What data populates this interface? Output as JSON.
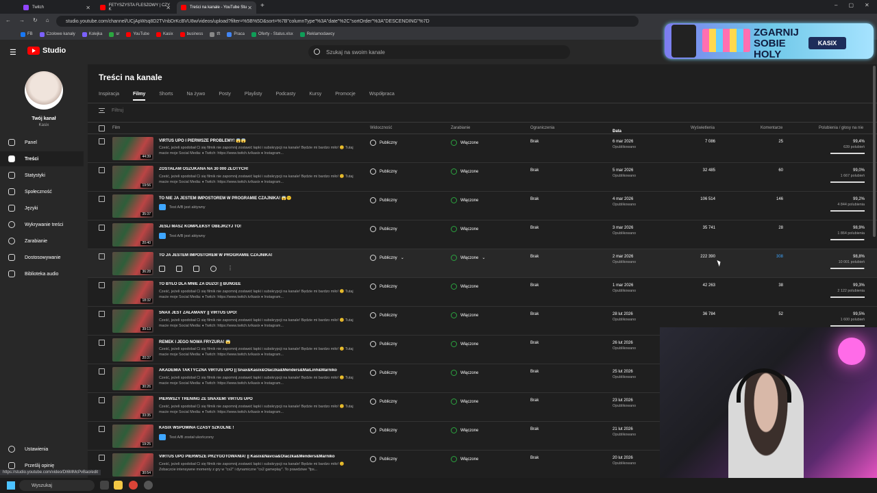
{
  "browser": {
    "tabs": [
      {
        "label": "Twitch",
        "color": "#9146ff"
      },
      {
        "label": "FETYSZYSTA FLESZOWY | CZY K",
        "color": "#ff0000"
      },
      {
        "label": "Treści na kanale - YouTube Stu",
        "color": "#ff0000"
      }
    ],
    "url": "studio.youtube.com/channel/UCjApWsq8D2TVnbDrKcBVU8w/videos/upload?filter=%5B%5D&sort=%7B\"columnType\"%3A\"date\"%2C\"sortOrder\"%3A\"DESCENDING\"%7D",
    "bookmarks": [
      "FB",
      "Czołowe kanały",
      "Kolejka",
      "sr",
      "YouTube",
      "Kasix",
      "business",
      "tft",
      "Praca",
      "Oferty - Status.xlsx",
      "Reklamodawcy"
    ]
  },
  "header": {
    "logo": "Studio",
    "search_placeholder": "Szukaj na swoim kanale"
  },
  "promo": {
    "text": "ZGARNIJ SOBIE HOLY HYDRATION",
    "badge": "KASIX"
  },
  "sidebar": {
    "channel_label": "Twój kanał",
    "channel_name": "Kasix",
    "items": [
      "Panel",
      "Treści",
      "Statystyki",
      "Społeczność",
      "Języki",
      "Wykrywanie treści",
      "Zarabianie",
      "Dostosowywanie",
      "Biblioteka audio"
    ],
    "bottom": [
      "Ustawienia",
      "Prześlij opinię"
    ]
  },
  "main": {
    "title": "Treści na kanale",
    "tabs": [
      "Inspiracja",
      "Filmy",
      "Shorts",
      "Na żywo",
      "Posty",
      "Playlisty",
      "Podcasty",
      "Kursy",
      "Promocje",
      "Współpraca"
    ],
    "filter_placeholder": "Filtruj",
    "columns": {
      "film": "Film",
      "visibility": "Widoczność",
      "monetization": "Zarabianie",
      "restrictions": "Ograniczenia",
      "date": "Data",
      "views": "Wyświetlenia",
      "comments": "Komentarze",
      "likes": "Polubienia / głosy na nie"
    }
  },
  "rows": [
    {
      "title": "VIRTUS UPO I PIERWSZE PROBLEMY! 😱😱",
      "desc": "Cześć, jeżeli spodobał Ci się filmik nie zapomnij zostawić łapki i subskrypcji na kanale! Będzie mi bardzo miło! 😊 Tutaj macie moje Social Media: ♦ Twitch: https://www.twitch.tv/kasix ♦ Instagram...",
      "ab": "",
      "duration": "44:39",
      "visibility": "Publiczny",
      "monetization": "Włączone",
      "restrictions": "Brak",
      "date": "6 mar 2026",
      "status": "Opublikowano",
      "views": "7 086",
      "comments": "25",
      "likes_pct": "99,4%",
      "likes": "639 polubień",
      "ratio": 0.994
    },
    {
      "title": "ZOSTAŁAM OSZUKANA NA 30 000 ZŁOTYCH!",
      "desc": "Cześć, jeżeli spodobał Ci się filmik nie zapomnij zostawić łapki i subskrypcji na kanale! Będzie mi bardzo miło! 😊 Tutaj macie moje Social Media: ♦ Twitch: https://www.twitch.tv/kasix ♦ Instagram...",
      "ab": "",
      "duration": "19:56",
      "visibility": "Publiczny",
      "monetization": "Włączone",
      "restrictions": "Brak",
      "date": "5 mar 2026",
      "status": "Opublikowano",
      "views": "32 485",
      "comments": "60",
      "likes_pct": "99,0%",
      "likes": "1 667 polubień",
      "ratio": 0.99
    },
    {
      "title": "TO NIE JA JESTEM IMPOSTOREM W PROGRAMIE CZAJNIKA! 😱🤨",
      "desc": "",
      "ab": "Test A/B jest aktywny",
      "duration": "35:37",
      "visibility": "Publiczny",
      "monetization": "Włączone",
      "restrictions": "Brak",
      "date": "4 mar 2026",
      "status": "Opublikowano",
      "views": "106 514",
      "comments": "146",
      "likes_pct": "99,2%",
      "likes": "4 844 polubienia",
      "ratio": 0.992
    },
    {
      "title": "JEŚLI MASZ KOMPLEKSY OBEJRZYJ TO!",
      "desc": "",
      "ab": "Test A/B jest aktywny",
      "duration": "20:40",
      "visibility": "Publiczny",
      "monetization": "Włączone",
      "restrictions": "Brak",
      "date": "3 mar 2026",
      "status": "Opublikowano",
      "views": "35 741",
      "comments": "28",
      "likes_pct": "98,9%",
      "likes": "1 864 polubienia",
      "ratio": 0.989
    },
    {
      "title": "TO JA JESTEM IMPOSTOREM W PROGRAMIE CZAJNIKA!",
      "desc": "",
      "ab": "",
      "duration": "36:28",
      "visibility": "Publiczny",
      "monetization": "Włączone",
      "restrictions": "Brak",
      "date": "2 mar 2026",
      "status": "Opublikowano",
      "views": "222 390",
      "comments": "308",
      "likes_pct": "98,8%",
      "likes": "10 001 polubień",
      "ratio": 0.988,
      "hover": true
    },
    {
      "title": "TO BYŁO DLA MNIE ZA DUŻO! || BUNGEE",
      "desc": "Cześć, jeżeli spodobał Ci się filmik nie zapomnij zostawić łapki i subskrypcji na kanale! Będzie mi bardzo miło! 😊 Tutaj macie moje Social Media: ♦ Twitch: https://www.twitch.tv/kasix ♦ Instagram...",
      "ab": "",
      "duration": "18:32",
      "visibility": "Publiczny",
      "monetization": "Włączone",
      "restrictions": "Brak",
      "date": "1 mar 2026",
      "status": "Opublikowano",
      "views": "42 263",
      "comments": "38",
      "likes_pct": "99,3%",
      "likes": "2 122 polubienia",
      "ratio": 0.993
    },
    {
      "title": "SNAX JEST ZAŁAMANY || VIRTUS UPO!",
      "desc": "Cześć, jeżeli spodobał Ci się filmik nie zapomnij zostawić łapki i subskrypcji na kanale! Będzie mi bardzo miło! 😊 Tutaj macie moje Social Media: ♦ Twitch: https://www.twitch.tv/kasix ♦ Instagram...",
      "ab": "",
      "duration": "39:13",
      "visibility": "Publiczny",
      "monetization": "Włączone",
      "restrictions": "Brak",
      "date": "28 lut 2026",
      "status": "Opublikowano",
      "views": "36 784",
      "comments": "52",
      "likes_pct": "99,5%",
      "likes": "1 600 polubień",
      "ratio": 0.995
    },
    {
      "title": "REMEK I JEGO NOWA FRYZURA! 😱",
      "desc": "Cześć, jeżeli spodobał Ci się filmik nie zapomnij zostawić łapki i subskrypcji na kanale! Będzie mi bardzo miło! 😊 Tutaj macie moje Social Media: ♦ Twitch: https://www.twitch.tv/kasix ♦ Instagram...",
      "ab": "",
      "duration": "20:37",
      "visibility": "Publiczny",
      "monetization": "Włączone",
      "restrictions": "Brak",
      "date": "26 lut 2026",
      "status": "Opublikowano",
      "views": "",
      "comments": "",
      "likes_pct": "",
      "likes": "",
      "ratio": 0
    },
    {
      "title": "AKADEMIA TAKTYCZNA VIRTUS UPO || Snax&Kasix&Olaczka&Menders&MaiLinh&Marniko",
      "desc": "Cześć, jeżeli spodobał Ci się filmik nie zapomnij zostawić łapki i subskrypcji na kanale! Będzie mi bardzo miło! 😊 Tutaj macie moje Social Media: ♦ Twitch: https://www.twitch.tv/kasix ♦ Instagram...",
      "ab": "",
      "duration": "30:26",
      "visibility": "Publiczny",
      "monetization": "Włączone",
      "restrictions": "Brak",
      "date": "25 lut 2026",
      "status": "Opublikowano",
      "views": "",
      "comments": "",
      "likes_pct": "",
      "likes": "",
      "ratio": 0
    },
    {
      "title": "PIERWSZY TRENING ZE SNAXEM! VIRTUS UPO",
      "desc": "Cześć, jeżeli spodobał Ci się filmik nie zapomnij zostawić łapki i subskrypcji na kanale! Będzie mi bardzo miło! 😊 Tutaj macie moje Social Media: ♦ Twitch: https://www.twitch.tv/kasix ♦ Instagram...",
      "ab": "",
      "duration": "33:35",
      "visibility": "Publiczny",
      "monetization": "Włączone",
      "restrictions": "Brak",
      "date": "23 lut 2026",
      "status": "Opublikowano",
      "views": "",
      "comments": "",
      "likes_pct": "",
      "likes": "",
      "ratio": 0
    },
    {
      "title": "KASIX WSPOMINA CZASY SZKOLNE !",
      "desc": "",
      "ab": "Test A/B został ukończony",
      "duration": "19:25",
      "visibility": "Publiczny",
      "monetization": "Włączone",
      "restrictions": "Brak",
      "date": "21 lut 2026",
      "status": "Opublikowano",
      "views": "",
      "comments": "",
      "likes_pct": "",
      "likes": "",
      "ratio": 0
    },
    {
      "title": "VIRTUS UPO PIERWSZE PRZYGOTOWANIA! || Kasix&Navcia&Olaczka&Menders&Marniko",
      "desc": "Cześć, jeżeli spodobał Ci się filmik nie zapomnij zostawić łapki i subskrypcji na kanale! Będzie mi bardzo miło! 😊 Zobaczcie intensywne momenty z gry w \"cs2\" i dynamiczne \"cs2 gameplay\". To prawdziwe \"fps...",
      "ab": "",
      "duration": "30:54",
      "visibility": "Publiczny",
      "monetization": "Włączone",
      "restrictions": "Brak",
      "date": "20 lut 2026",
      "status": "Opublikowano",
      "views": "",
      "comments": "",
      "likes_pct": "",
      "likes": "",
      "ratio": 0
    }
  ],
  "taskbar": {
    "search": "Wyszukaj"
  },
  "status_url": "https://studio.youtube.com/video/DI6MMcPvBao/edit"
}
